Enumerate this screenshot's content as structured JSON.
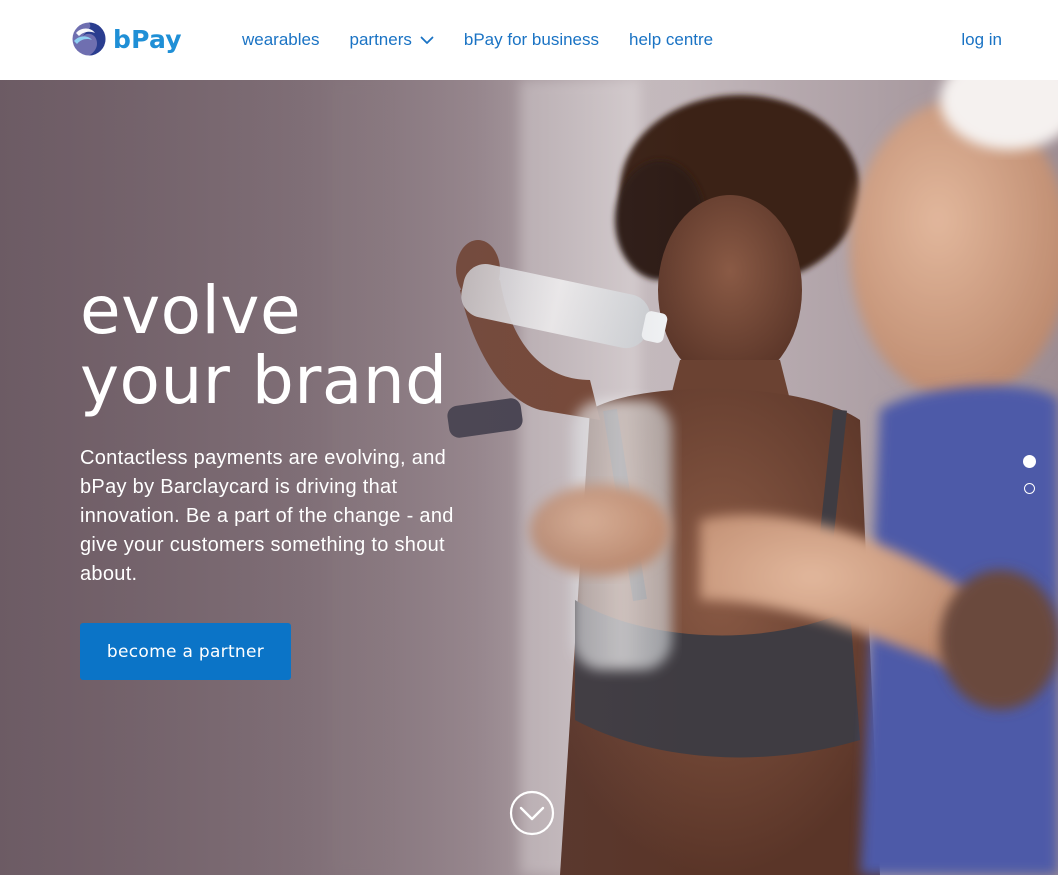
{
  "brand": {
    "name": "bPay",
    "color": "#1f8fd6"
  },
  "nav": {
    "items": [
      {
        "label": "wearables"
      },
      {
        "label": "partners",
        "icon": "chevron-down-icon"
      },
      {
        "label": "bPay for business"
      },
      {
        "label": "help centre"
      }
    ],
    "login_label": "log in",
    "link_color": "#1a73c4"
  },
  "hero": {
    "headline_line1": "evolve",
    "headline_line2": "your brand",
    "lead": "Contactless payments are evolving, and bPay by Barclaycard is driving that innovation. Be a part of the change - and give your customers something to shout about.",
    "cta_label": "become a partner",
    "cta_color": "#0b74c7",
    "slides": [
      {
        "active": true
      },
      {
        "active": false
      }
    ],
    "scroll_icon": "chevron-circle-down-icon"
  }
}
